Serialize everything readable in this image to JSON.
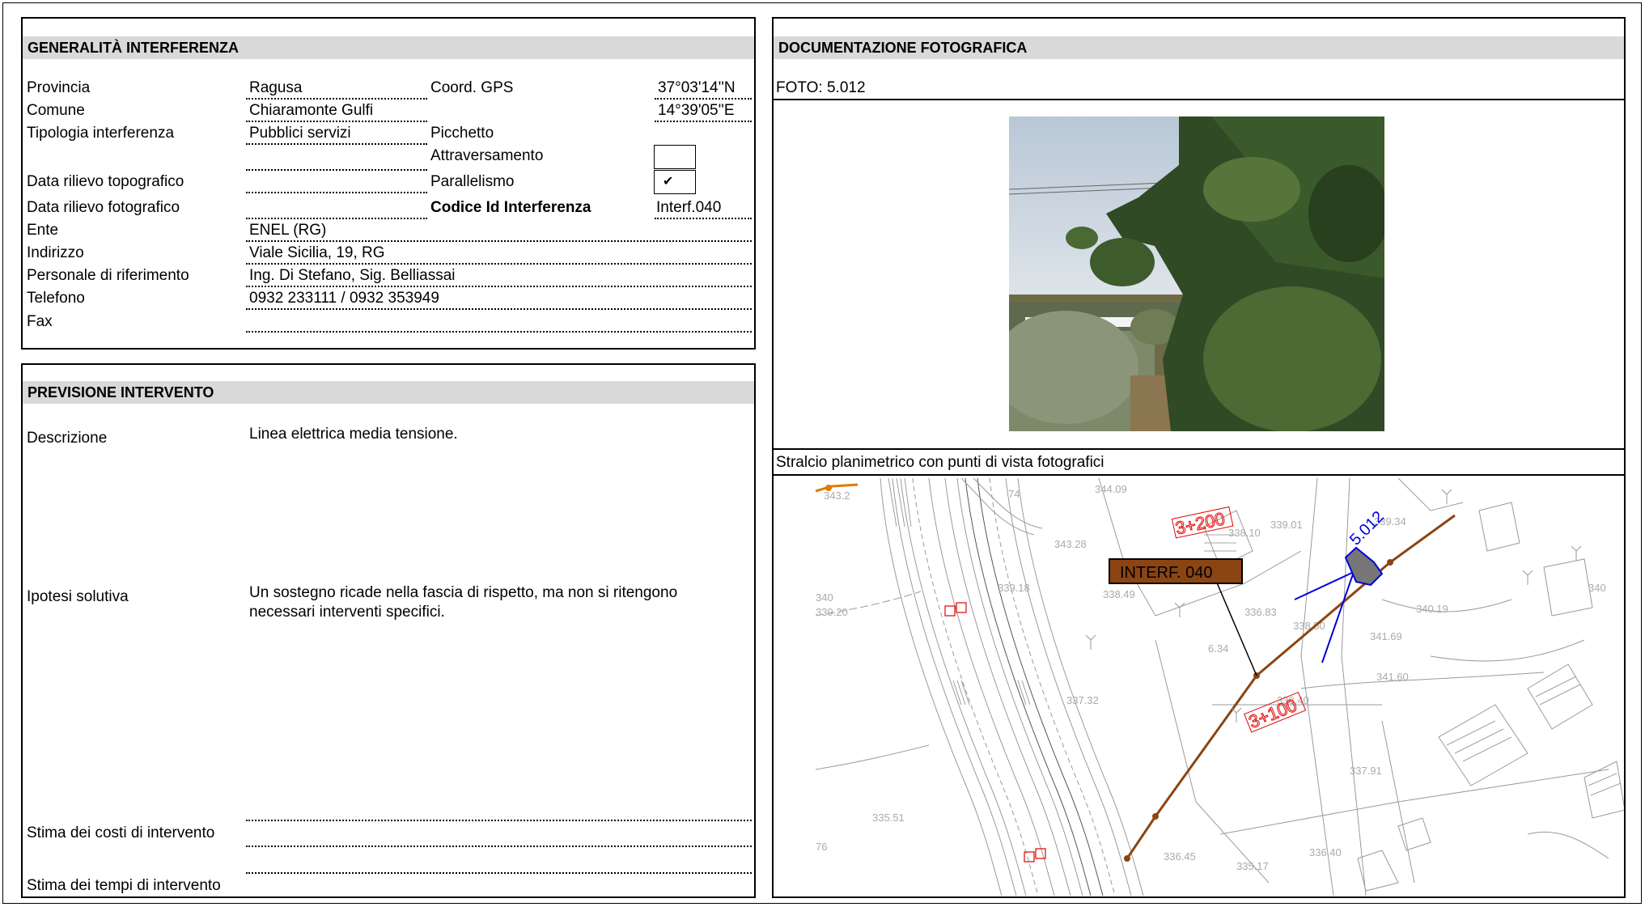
{
  "generalita": {
    "title": "GENERALITÀ  INTERFERENZA",
    "rows": {
      "provincia_label": "Provincia",
      "provincia_value": "Ragusa",
      "comune_label": "Comune",
      "comune_value": "Chiaramonte Gulfi",
      "tipologia_label": "Tipologia interferenza",
      "tipologia_value": "Pubblici servizi",
      "data_topo_label": "Data rilievo topografico",
      "data_foto_label": "Data rilievo fotografico",
      "ente_label": "Ente",
      "ente_value": "ENEL (RG)",
      "indirizzo_label": "Indirizzo",
      "indirizzo_value": "Viale Sicilia, 19, RG",
      "personale_label": "Personale di riferimento",
      "personale_value": "Ing. Di Stefano, Sig. Belliassai",
      "telefono_label": "Telefono",
      "telefono_value": "0932 233111 / 0932 353949",
      "fax_label": "Fax"
    },
    "coord_label": "Coord. GPS",
    "coord_n": "37°03'14''N",
    "coord_e": "14°39'05''E",
    "picchetto_label": "Picchetto",
    "attraversamento_label": "Attraversamento",
    "parallelismo_label": "Parallelismo",
    "parallelismo_mark": "✔",
    "codice_label": "Codice Id Interferenza",
    "codice_value": "Interf.040"
  },
  "previsione": {
    "title": "PREVISIONE INTERVENTO",
    "descrizione_label": "Descrizione",
    "descrizione_value": "Linea elettrica media tensione.",
    "ipotesi_label": "Ipotesi solutiva",
    "ipotesi_line1": "Un sostegno ricade nella fascia di rispetto, ma non si ritengono",
    "ipotesi_line2": "necessari interventi specifici.",
    "costi_label": "Stima dei costi di intervento",
    "tempi_label": "Stima dei tempi di intervento"
  },
  "documentazione": {
    "title": "DOCUMENTAZIONE FOTOGRAFICA",
    "foto_label": "FOTO: 5.012",
    "stralcio_label": "Stralcio planimetrico con punti di vista fotografici"
  },
  "map": {
    "interf_label": "INTERF. 040",
    "chainage_1": "3+200",
    "chainage_2": "3+100",
    "view_label": "5.012",
    "elevations": [
      "343.2",
      "344.09",
      "343.28",
      "339.18",
      "338.49",
      "340",
      "339.20",
      "338.10",
      "339.01",
      "339.34",
      "336.83",
      "338.50",
      "340.19",
      "337.32",
      "338.40",
      "337.91",
      "335.51",
      "336.45",
      "335.17",
      "336.40",
      "340",
      "6.34",
      "341.69",
      "341.60",
      "74",
      "76"
    ],
    "colors": {
      "line": "#8b4513",
      "interf_fill": "#8b4513",
      "chainage": "#e00000",
      "view": "#0000dd",
      "base": "#888888"
    }
  }
}
